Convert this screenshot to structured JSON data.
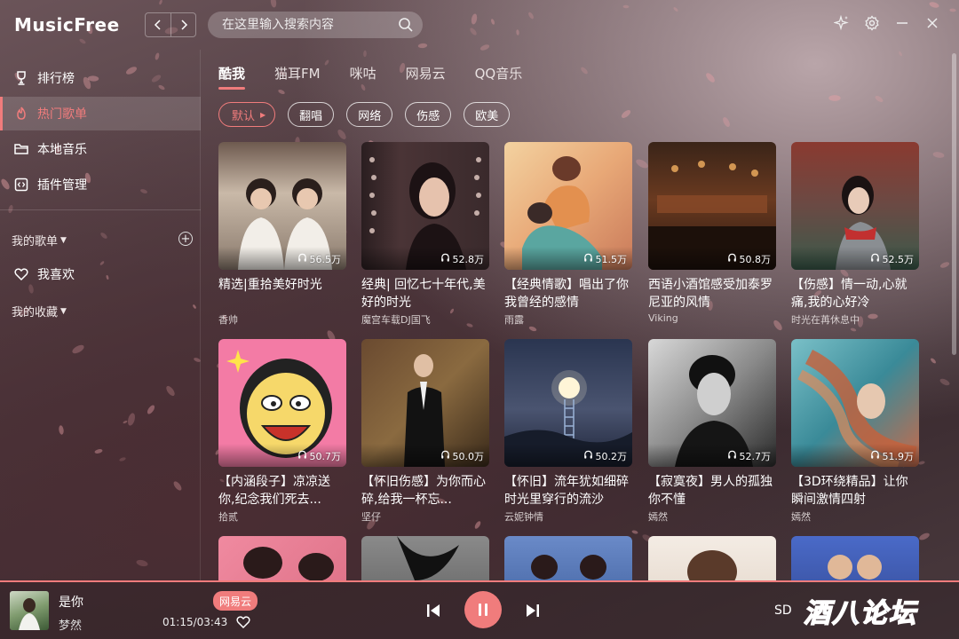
{
  "app": {
    "title": "MusicFree"
  },
  "titlebar": {
    "back_icon": "chevron-left-icon",
    "forward_icon": "chevron-right-icon",
    "search_placeholder": "在这里输入搜索内容"
  },
  "sidebar": {
    "items": [
      {
        "label": "排行榜",
        "icon": "trophy-icon",
        "active": false
      },
      {
        "label": "热门歌单",
        "icon": "fire-icon",
        "active": true
      },
      {
        "label": "本地音乐",
        "icon": "folder-icon",
        "active": false
      },
      {
        "label": "插件管理",
        "icon": "plugin-icon",
        "active": false
      }
    ],
    "my_playlists": "我的歌单",
    "favorite": "我喜欢",
    "my_collection": "我的收藏"
  },
  "tabs": [
    {
      "label": "酷我",
      "active": true
    },
    {
      "label": "猫耳FM",
      "active": false
    },
    {
      "label": "咪咕",
      "active": false
    },
    {
      "label": "网易云",
      "active": false
    },
    {
      "label": "QQ音乐",
      "active": false
    }
  ],
  "chips": [
    {
      "label": "默认",
      "active": true
    },
    {
      "label": "翻唱",
      "active": false
    },
    {
      "label": "网络",
      "active": false
    },
    {
      "label": "伤感",
      "active": false
    },
    {
      "label": "欧美",
      "active": false
    }
  ],
  "playlists": [
    {
      "title": "精选|重拾美好时光",
      "author": "香帅",
      "plays": "56.5万"
    },
    {
      "title": "经典| 回忆七十年代,美好的时光",
      "author": "魔宫车载DJ国飞",
      "plays": "52.8万"
    },
    {
      "title": "【经典情歌】唱出了你我曾经的感情",
      "author": "雨露",
      "plays": "51.5万"
    },
    {
      "title": "西语小酒馆感受加泰罗尼亚的风情",
      "author": "Viking",
      "plays": "50.8万"
    },
    {
      "title": "【伤感】情一动,心就痛,我的心好冷",
      "author": "时光在苒休息中",
      "plays": "52.5万"
    },
    {
      "title": "【内涵段子】凉凉送你,纪念我们死去...",
      "author": "拾贰",
      "plays": "50.7万"
    },
    {
      "title": "【怀旧伤感】为你而心碎,给我一杯忘...",
      "author": "坚仔",
      "plays": "50.0万"
    },
    {
      "title": "【怀旧】流年犹如细碎时光里穿行的流沙",
      "author": "云妮钟情",
      "plays": "50.2万"
    },
    {
      "title": "【寂寞夜】男人的孤独你不懂",
      "author": "嫣然",
      "plays": "52.7万"
    },
    {
      "title": "【3D环绕精品】让你瞬间激情四射",
      "author": "嫣然",
      "plays": "51.9万"
    }
  ],
  "player": {
    "title": "是你",
    "artist": "梦然",
    "source": "网易云",
    "time": "01:15/03:43",
    "quality": "SD"
  },
  "watermark": "酒八论坛",
  "colors": {
    "accent": "#f07c7c",
    "watermark": "#3b78e7"
  }
}
